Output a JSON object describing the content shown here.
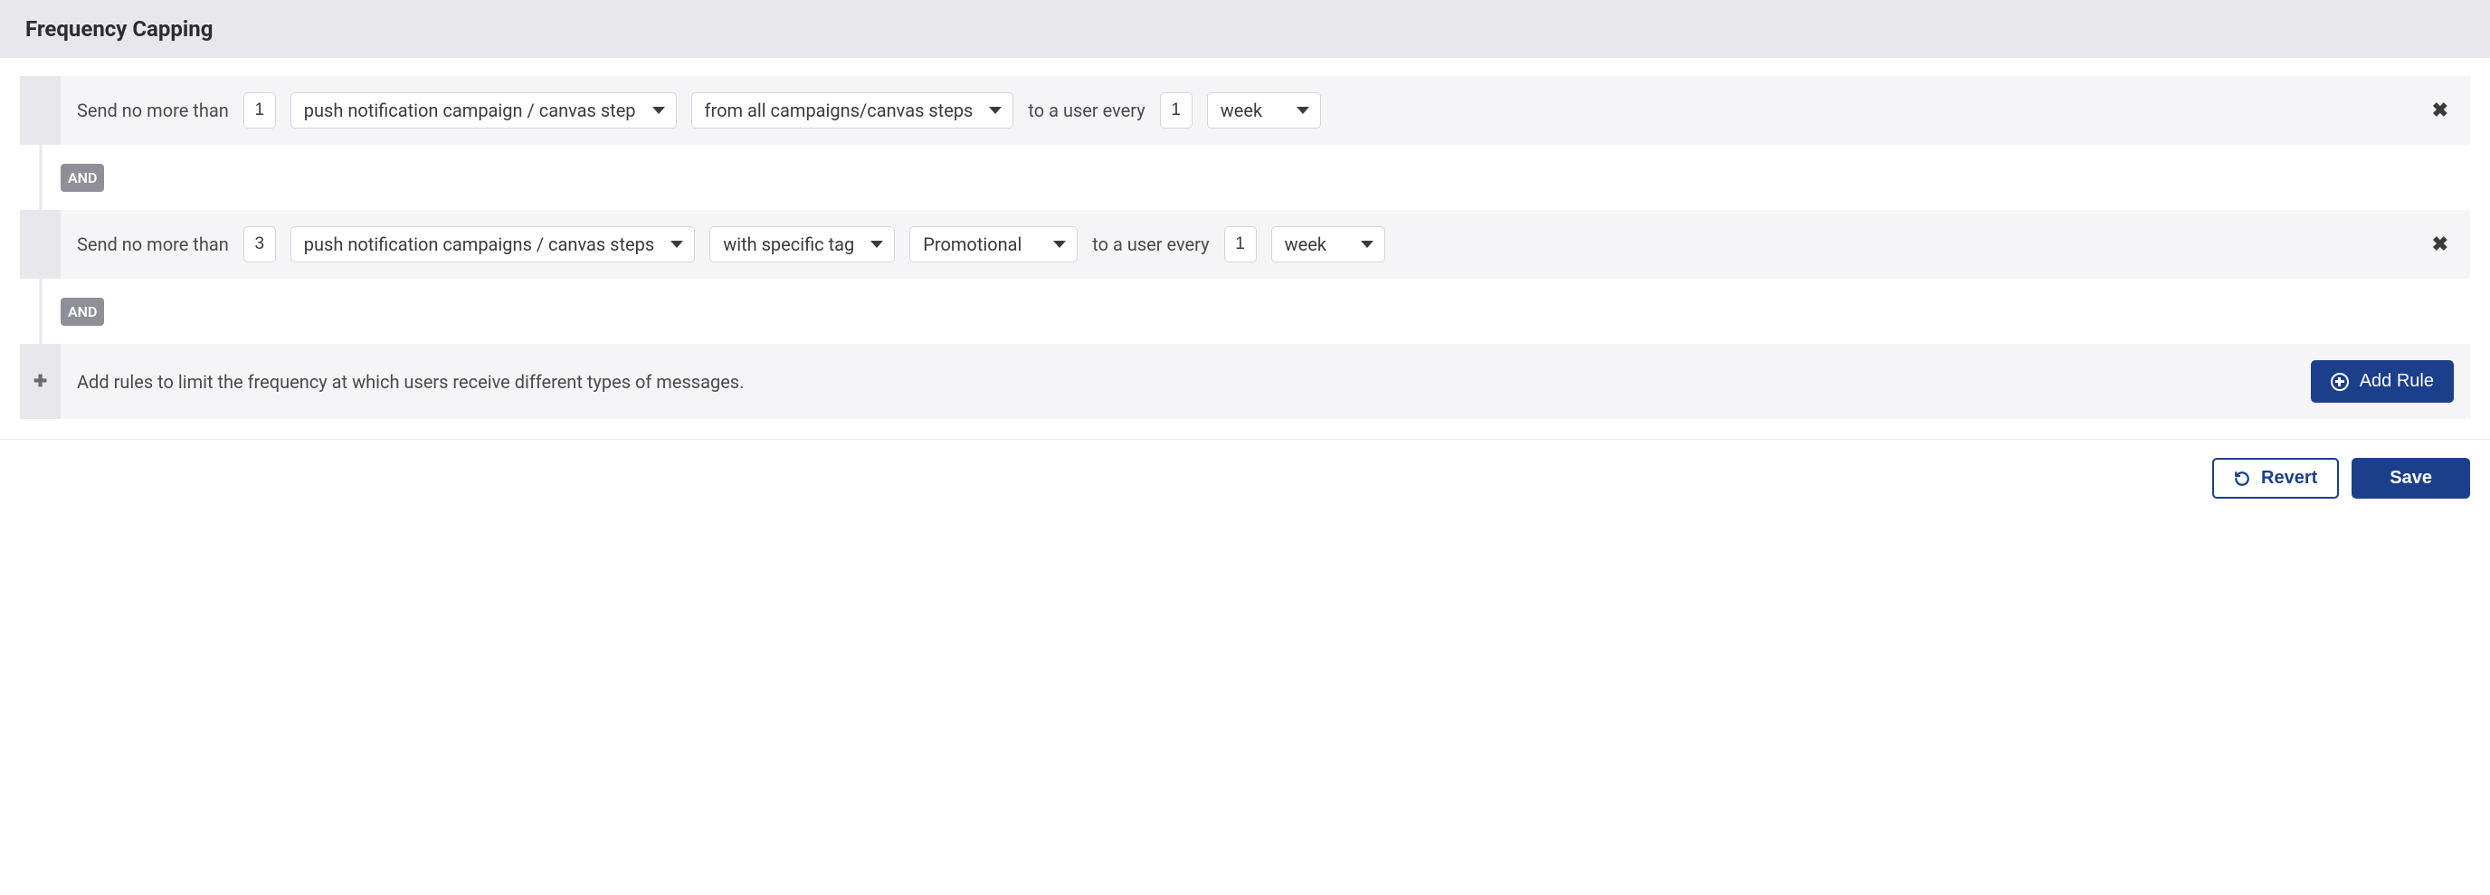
{
  "header": {
    "title": "Frequency Capping"
  },
  "labels": {
    "send_no_more_than": "Send no more than",
    "to_a_user_every": "to a user every",
    "connector": "AND",
    "add_rules_hint": "Add rules to limit the frequency at which users receive different types of messages.",
    "add_rule": "Add Rule",
    "revert": "Revert",
    "save": "Save",
    "plus_symbol": "✚"
  },
  "rules": [
    {
      "count": "1",
      "channel": "push notification campaign / canvas step",
      "scope": "from all campaigns/canvas steps",
      "tag": null,
      "period_count": "1",
      "period_unit": "week"
    },
    {
      "count": "3",
      "channel": "push notification campaigns / canvas steps",
      "scope": "with specific tag",
      "tag": "Promotional",
      "period_count": "1",
      "period_unit": "week"
    }
  ]
}
